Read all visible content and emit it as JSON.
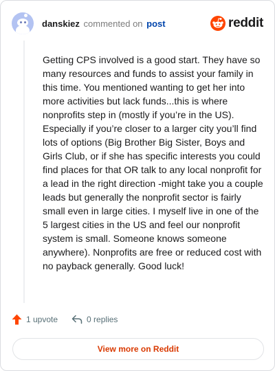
{
  "header": {
    "username": "danskiez",
    "action_text": "commented on",
    "post_link": "post",
    "logo_text": "reddit"
  },
  "comment": {
    "body": "Getting CPS involved is a good start. They have so many resources and funds to assist your family in this time. You mentioned wanting to get her into more activities but lack funds...this is where nonprofits step in (mostly if you’re in the US). Especially if you’re closer to a larger city you’ll find lots of options (Big Brother Big Sister, Boys and Girls Club, or if she has specific interests you could find places for that OR talk to any local nonprofit for a lead in the right direction -might take you a couple leads but generally the nonprofit sector is fairly small even in large cities. I myself live in one of the 5 largest cities in the US and feel our nonprofit system is small. Someone knows someone anywhere). Nonprofits are free or reduced cost with no payback generally. Good luck!"
  },
  "actions": {
    "upvote_label": "1 upvote",
    "replies_label": "0 replies"
  },
  "footer": {
    "view_button_label": "View more on Reddit"
  },
  "colors": {
    "brand": "#ff4500",
    "link": "#0045ac",
    "button_text": "#d93900",
    "avatar_bg": "#b3c3f2"
  },
  "icons": {
    "avatar": "snoo-avatar-icon",
    "logo": "reddit-logo-icon",
    "upvote": "upvote-arrow-icon",
    "reply": "reply-arrow-icon"
  }
}
